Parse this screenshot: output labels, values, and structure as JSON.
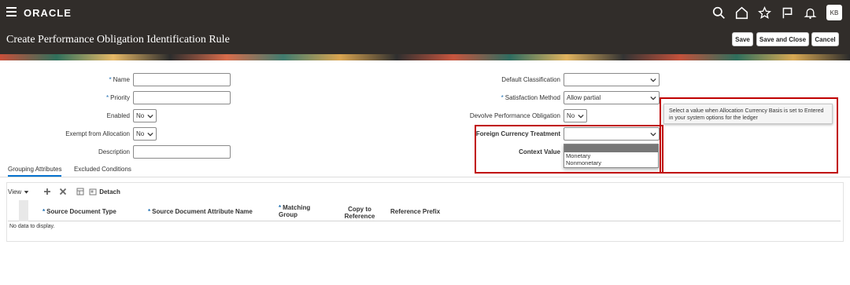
{
  "header": {
    "brand": "ORACLE",
    "avatar": "KB",
    "icons": [
      "menu-icon",
      "search-icon",
      "home-icon",
      "star-icon",
      "flag-icon",
      "bell-icon"
    ]
  },
  "page": {
    "title": "Create Performance Obligation Identification Rule",
    "buttons": {
      "save": "Save",
      "save_close": "Save and Close",
      "cancel": "Cancel"
    }
  },
  "form": {
    "left": {
      "name": {
        "label": "Name",
        "value": ""
      },
      "priority": {
        "label": "Priority",
        "value": ""
      },
      "enabled": {
        "label": "Enabled",
        "value": "No"
      },
      "exempt": {
        "label": "Exempt from Allocation",
        "value": "No"
      },
      "description": {
        "label": "Description",
        "value": ""
      }
    },
    "right": {
      "default_classification": {
        "label": "Default Classification",
        "value": ""
      },
      "satisfaction_method": {
        "label": "Satisfaction Method",
        "value": "Allow partial"
      },
      "devolve": {
        "label": "Devolve Performance Obligation",
        "value": "No"
      },
      "foreign_currency": {
        "label": "Foreign Currency Treatment",
        "value": ""
      },
      "context_value": {
        "label": "Context Value"
      }
    },
    "required_marker": "*"
  },
  "dropdown": {
    "options": [
      "Monetary",
      "Nonmonetary"
    ]
  },
  "tooltip": {
    "text": "Select a value when Allocation Currency Basis is set to Entered in your system options for the ledger"
  },
  "tabs": [
    "Grouping Attributes",
    "Excluded Conditions"
  ],
  "table": {
    "toolbar": {
      "view": "View",
      "detach": "Detach"
    },
    "columns": [
      "Source Document Type",
      "Source Document Attribute Name",
      "Matching Group",
      "Copy to Reference",
      "Reference Prefix"
    ],
    "empty_text": "No data to display."
  },
  "colors": {
    "header_bg": "#312d2a",
    "highlight": "#c00000",
    "required": "#1f6fb2",
    "tab_active": "#0572ce"
  }
}
